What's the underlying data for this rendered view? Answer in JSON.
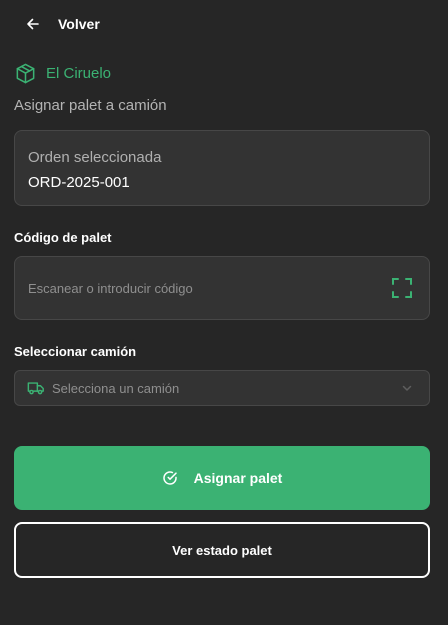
{
  "header": {
    "back_label": "Volver",
    "back_icon": "arrow-left-icon"
  },
  "brand": {
    "name": "El Ciruelo",
    "icon": "package-icon",
    "color": "#3bb273"
  },
  "subtitle": "Asignar palet a camión",
  "order_card": {
    "label": "Orden seleccionada",
    "value": "ORD-2025-001"
  },
  "pallet_field": {
    "label": "Código de palet",
    "value": "",
    "placeholder": "Escanear o introducir código",
    "icon": "scan-icon"
  },
  "truck_field": {
    "label": "Seleccionar camión",
    "placeholder": "Selecciona un camión",
    "icon": "truck-icon",
    "dropdown_icon": "chevron-down-icon"
  },
  "actions": {
    "assign_label": "Asignar palet",
    "assign_icon": "check-circle-icon",
    "status_label": "Ver estado palet"
  },
  "colors": {
    "accent": "#3bb273",
    "background": "#262626",
    "card": "#333333"
  }
}
